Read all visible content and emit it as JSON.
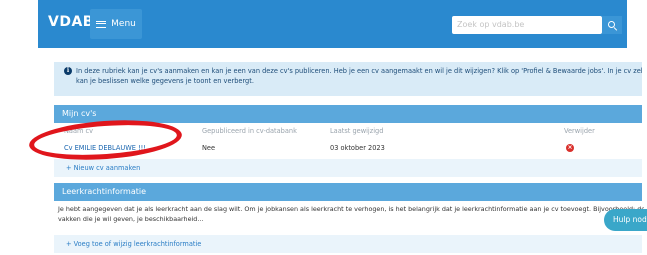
{
  "header": {
    "logo_text": "VDAB",
    "menu_label": "Menu",
    "search_placeholder": "Zoek op vdab.be"
  },
  "info": {
    "line1": "In deze rubriek kan je cv's aanmaken en kan je een van deze cv's publiceren. Heb je een cv aangemaakt en wil je dit wijzigen? Klik op 'Profiel & Bewaarde jobs'. In je cv zelf",
    "line2": "kan je beslissen welke gegevens je toont en verbergt."
  },
  "cvs": {
    "title": "Mijn cv's",
    "columns": [
      "Naam cv",
      "Gepubliceerd in cv-databank",
      "Laatst gewijzigd",
      "Verwijder"
    ],
    "rows": [
      {
        "name": "Cv EMILIE DEBLAUWE !!!",
        "published": "Nee",
        "modified": "03 oktober 2023"
      }
    ],
    "add_label": "+ Nieuw cv aanmaken"
  },
  "teacher": {
    "title": "Leerkrachtinformatie",
    "line1": "Je hebt aangegeven dat je als leerkracht aan de slag wilt. Om je jobkansen als leerkracht te verhogen, is het belangrijk dat je leerkrachtinformatie aan je cv toevoegt. Bijvoorbeeld: de",
    "line2": "vakken die je wil geven, je beschikbaarheid...",
    "add_label": "+ Voeg toe of wijzig leerkrachtinformatie"
  },
  "help_label": "Hulp nodig?",
  "colors": {
    "header_blue": "#2a89cf",
    "card_head_blue": "#5ba8dc",
    "annotation_red": "#e0161c",
    "delete_red": "#d9302c"
  }
}
